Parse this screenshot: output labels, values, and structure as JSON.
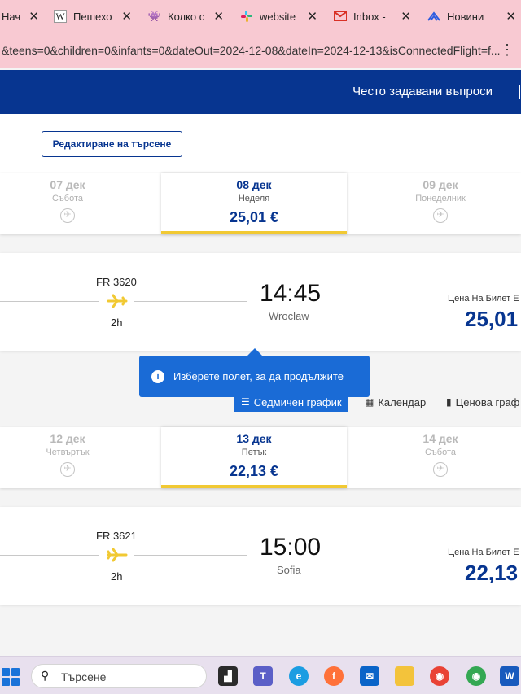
{
  "browser": {
    "tabs": [
      {
        "favicon": "home-icon",
        "title": "Нач",
        "color": "#e0a6b0"
      },
      {
        "favicon": "wikipedia-icon",
        "title": "Пешехо",
        "color": "#ffffff"
      },
      {
        "favicon": "alien-icon",
        "title": "Колко с",
        "color": "#5b3a6e"
      },
      {
        "favicon": "slack-icon",
        "title": "website",
        "color": "#e01e5a"
      },
      {
        "favicon": "gmail-icon",
        "title": "Inbox - ",
        "color": "#d93025"
      },
      {
        "favicon": "news-icon",
        "title": "Новини",
        "color": "#2c5be0"
      }
    ],
    "close_glyph": "✕",
    "url": "&teens=0&children=0&infants=0&dateOut=2024-12-08&dateIn=2024-12-13&isConnectedFlight=f...",
    "menu_glyph": "⋮"
  },
  "header": {
    "faq": "Често задавани въпроси",
    "brand_color": "#073590"
  },
  "search": {
    "edit_button": "Редактиране на търсене"
  },
  "outbound": {
    "dates": [
      {
        "date": "07 дек",
        "weekday": "Събота",
        "price": null
      },
      {
        "date": "08 дек",
        "weekday": "Неделя",
        "price": "25,01 €"
      },
      {
        "date": "09 дек",
        "weekday": "Понеделник",
        "price": null
      }
    ],
    "flight": {
      "number": "FR 3620",
      "duration": "2h",
      "time": "14:45",
      "city": "Wroclaw",
      "price_label": "Цена На Билет Е",
      "price": "25,01"
    }
  },
  "tooltip": {
    "message": "Изберете полет, за да продължите"
  },
  "view_tabs": [
    {
      "label": "Седмичен график",
      "icon": "list-icon",
      "active": true
    },
    {
      "label": "Календар",
      "icon": "calendar-icon",
      "active": false
    },
    {
      "label": "Ценова граф",
      "icon": "bar-chart-icon",
      "active": false
    }
  ],
  "inbound": {
    "dates": [
      {
        "date": "12 дек",
        "weekday": "Четвъртък",
        "price": null
      },
      {
        "date": "13 дек",
        "weekday": "Петък",
        "price": "22,13 €"
      },
      {
        "date": "14 дек",
        "weekday": "Събота",
        "price": null
      }
    ],
    "flight": {
      "number": "FR 3621",
      "duration": "2h",
      "time": "15:00",
      "city": "Sofia",
      "price_label": "Цена На Билет Е",
      "price": "22,13"
    }
  },
  "taskbar": {
    "search_placeholder": "Търсене",
    "apps": [
      "file-explorer-icon",
      "teams-icon",
      "edge-icon",
      "firefox-icon",
      "mail-icon",
      "folder-icon",
      "chrome-icon",
      "chrome-profile-icon",
      "word-icon"
    ]
  }
}
